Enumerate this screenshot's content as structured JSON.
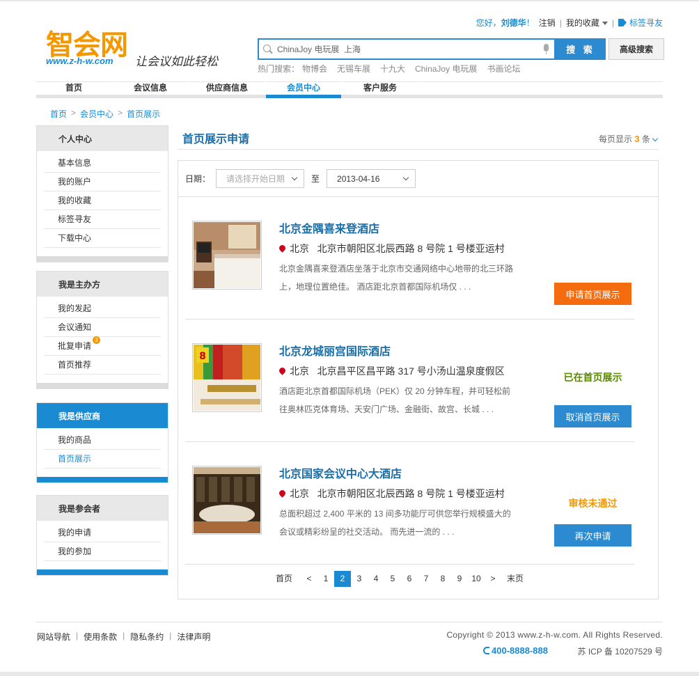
{
  "logo": {
    "name": "智会网",
    "url": "www.z-h-w.com",
    "slogan": "让会议如此轻松"
  },
  "topbar": {
    "hello": "您好，",
    "user": "刘德华",
    "excl": "！",
    "logout": "注销",
    "favorites": "我的收藏",
    "tag_friends": "标签寻友"
  },
  "search": {
    "value": "ChinaJoy 电玩展  上海",
    "button": "搜 索",
    "advanced": "高级搜索",
    "hot_label": "热门搜索：",
    "hot": [
      "物博会",
      "无锡车展",
      "十九大",
      "ChinaJoy 电玩展",
      "书画论坛"
    ]
  },
  "nav": [
    "首页",
    "会议信息",
    "供应商信息",
    "会员中心",
    "客户服务"
  ],
  "nav_active": "会员中心",
  "breadcrumb": [
    "首页",
    "会员中心",
    "首页展示"
  ],
  "sidebar": [
    {
      "title": "个人中心",
      "items": [
        "基本信息",
        "我的账户",
        "我的收藏",
        "标签寻友",
        "下载中心"
      ]
    },
    {
      "title": "我是主办方",
      "items": [
        "我的发起",
        "会议通知",
        "批复申请",
        "首页推荐"
      ],
      "badge": "3"
    },
    {
      "title": "我是供应商",
      "items": [
        "我的商品",
        "首页展示"
      ]
    },
    {
      "title": "我是参会者",
      "items": [
        "我的申请",
        "我的参加"
      ]
    }
  ],
  "main": {
    "title": "首页展示申请",
    "perpage_prefix": "每页显示",
    "perpage_value": "3",
    "perpage_suffix": "条",
    "filter": {
      "date_label": "日期：",
      "start_placeholder": "请选择开始日期",
      "to": "至",
      "end_value": "2013-04-16"
    }
  },
  "hotels": [
    {
      "name": "北京金隅喜来登酒店",
      "city": "北京",
      "address": "北京市朝阳区北辰西路 8 号院 1 号楼亚运村",
      "desc": "北京金隅喜来登酒店坐落于北京市交通网络中心地带的北三环路上，地理位置绝佳。 酒店距北京首都国际机场仅 . . .",
      "status": "",
      "action": "申请首页展示"
    },
    {
      "name": "北京龙城丽宫国际酒店",
      "city": "北京",
      "address": "北京昌平区昌平路 317 号小汤山温泉度假区",
      "desc": "酒店距北京首都国际机场（PEK）仅 20 分钟车程，并可轻松前往奥林匹克体育场、天安门广场、金融街、故宫、长城 . . .",
      "status": "已在首页展示",
      "action": "取消首页展示"
    },
    {
      "name": "北京国家会议中心大酒店",
      "city": "北京",
      "address": "北京市朝阳区北辰西路 8 号院 1 号楼亚运村",
      "desc": "总面积超过 2,400 平米的 13 间多功能厅可供您举行规模盛大的会议或精彩纷呈的社交活动。 而先进一流的 . . .",
      "status": "审核未通过",
      "action": "再次申请"
    }
  ],
  "pager": {
    "first": "首页",
    "prev": "<",
    "pages": [
      "1",
      "2",
      "3",
      "4",
      "5",
      "6",
      "7",
      "8",
      "9",
      "10"
    ],
    "current": "2",
    "next": ">",
    "last": "末页"
  },
  "footer": {
    "links": [
      "网站导航",
      "使用条款",
      "隐私条约",
      "法律声明"
    ],
    "copyright": "Copyright © 2013 www.z-h-w.com. All Rights Reserved.",
    "phone": "400-8888-888",
    "icp": "苏 ICP 备 10207529 号"
  },
  "colors": {
    "brand_blue": "#1a8ad2",
    "title_blue": "#1a6ea8",
    "orange": "#f56c0f",
    "status_green": "#5a8a00",
    "status_orange": "#f39800"
  },
  "icons": [
    "search-icon",
    "mic-icon",
    "tag-icon",
    "location-pin-icon",
    "phone-icon",
    "chevron-down-icon"
  ]
}
